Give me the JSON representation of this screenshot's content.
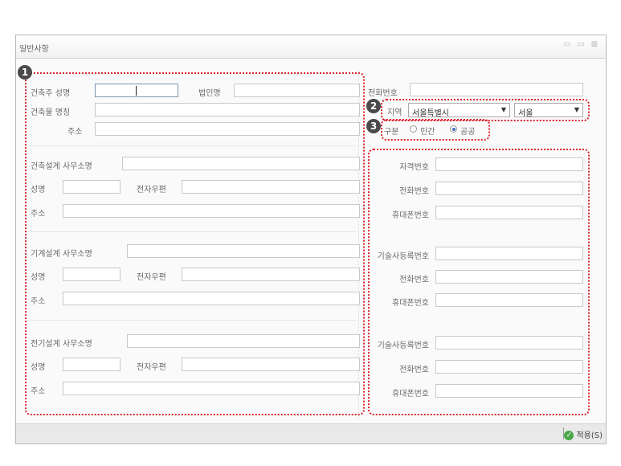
{
  "window": {
    "title": "일반사항",
    "min_icon": "minimize-icon",
    "max_icon": "maximize-icon",
    "close_icon": "close-icon",
    "min_glyph": "▭",
    "max_glyph": "▭",
    "close_glyph": "⊠"
  },
  "callouts": [
    "1",
    "2",
    "3"
  ],
  "left": {
    "owner": {
      "owner_name_label": "건축주 성명",
      "corp_name_label": "법인명",
      "building_name_label": "건축물 명칭",
      "address_label": "주소"
    },
    "arch": {
      "office_label": "건축설계 사무소명",
      "name_label": "성명",
      "postcode_label": "전자우편",
      "address_label": "주소"
    },
    "mech": {
      "office_label": "기계설계 사무소명",
      "name_label": "성명",
      "postcode_label": "전자우편",
      "address_label": "주소"
    },
    "elec": {
      "office_label": "전기설계 사무소명",
      "name_label": "성명",
      "postcode_label": "전자우편",
      "address_label": "주소"
    }
  },
  "right": {
    "phone_label": "전화번호",
    "region_label": "지역",
    "region_value": "서울특별시",
    "city_value": "서울",
    "type_label": "구분",
    "type_options": [
      "민간",
      "공공"
    ],
    "type_selected": "공공",
    "arch": {
      "license_label": "자격번호",
      "phone_label": "전화번호",
      "mobile_label": "휴대폰번호"
    },
    "mech": {
      "license_label": "기술사등록번호",
      "phone_label": "전화번호",
      "mobile_label": "휴대폰번호"
    },
    "elec": {
      "license_label": "기술사등록번호",
      "phone_label": "전화번호",
      "mobile_label": "휴대폰번호"
    }
  },
  "status": {
    "apply_label": "적용(S)",
    "apply_icon": "check-circle-icon"
  },
  "colors": {
    "callout_border": "#d9262f",
    "badge_bg": "#4a4a4a"
  }
}
